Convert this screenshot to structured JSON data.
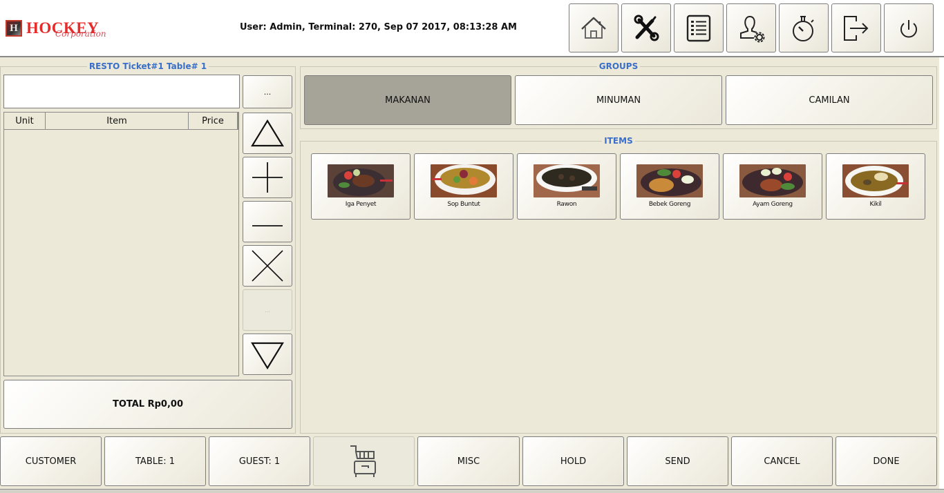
{
  "header": {
    "logo": {
      "mark": "H",
      "name": "HOCKEY",
      "tagline": "Corporation"
    },
    "status": "User: Admin, Terminal: 270, Sep 07 2017, 08:13:28 AM",
    "toolbar": [
      {
        "name": "home",
        "icon": "home-icon"
      },
      {
        "name": "settings",
        "icon": "tools-icon"
      },
      {
        "name": "orders-list",
        "icon": "list-icon"
      },
      {
        "name": "user-settings",
        "icon": "user-gear-icon"
      },
      {
        "name": "timer",
        "icon": "stopwatch-icon"
      },
      {
        "name": "logout",
        "icon": "logout-icon"
      },
      {
        "name": "power",
        "icon": "power-icon"
      }
    ]
  },
  "ticket": {
    "title": "RESTO Ticket#1 Table# 1",
    "input_value": "",
    "more_label": "...",
    "columns": [
      "Unit",
      "Item",
      "Price"
    ],
    "rows": [],
    "side_buttons": [
      {
        "name": "scroll-up",
        "icon": "triangle-up-icon"
      },
      {
        "name": "add-qty",
        "icon": "plus-icon"
      },
      {
        "name": "remove-qty",
        "icon": "minus-icon"
      },
      {
        "name": "delete-item",
        "icon": "x-icon"
      },
      {
        "name": "more-options",
        "label": "...",
        "disabled": true
      },
      {
        "name": "scroll-down",
        "icon": "triangle-down-icon"
      }
    ],
    "total_label": "TOTAL Rp0,00"
  },
  "groups": {
    "title": "GROUPS",
    "items": [
      {
        "label": "MAKANAN",
        "selected": true
      },
      {
        "label": "MINUMAN",
        "selected": false
      },
      {
        "label": "CAMILAN",
        "selected": false
      }
    ]
  },
  "items": {
    "title": "ITEMS",
    "list": [
      {
        "label": "Iga Penyet"
      },
      {
        "label": "Sop Buntut"
      },
      {
        "label": "Rawon"
      },
      {
        "label": "Bebek Goreng"
      },
      {
        "label": "Ayam Goreng"
      },
      {
        "label": "Kikil"
      }
    ]
  },
  "footer": {
    "buttons": [
      {
        "name": "customer",
        "label": "CUSTOMER"
      },
      {
        "name": "table",
        "label": "TABLE: 1"
      },
      {
        "name": "guest",
        "label": "GUEST: 1"
      },
      {
        "name": "cart",
        "icon": "cart-icon",
        "disabled": true
      },
      {
        "name": "misc",
        "label": "MISC"
      },
      {
        "name": "hold",
        "label": "HOLD"
      },
      {
        "name": "send",
        "label": "SEND"
      },
      {
        "name": "cancel",
        "label": "CANCEL"
      },
      {
        "name": "done",
        "label": "DONE"
      }
    ]
  },
  "colors": {
    "background": "#ece9d8",
    "group_title": "#3a6fc9",
    "selected_group": "#a6a398",
    "logo_red": "#e62b2b"
  }
}
